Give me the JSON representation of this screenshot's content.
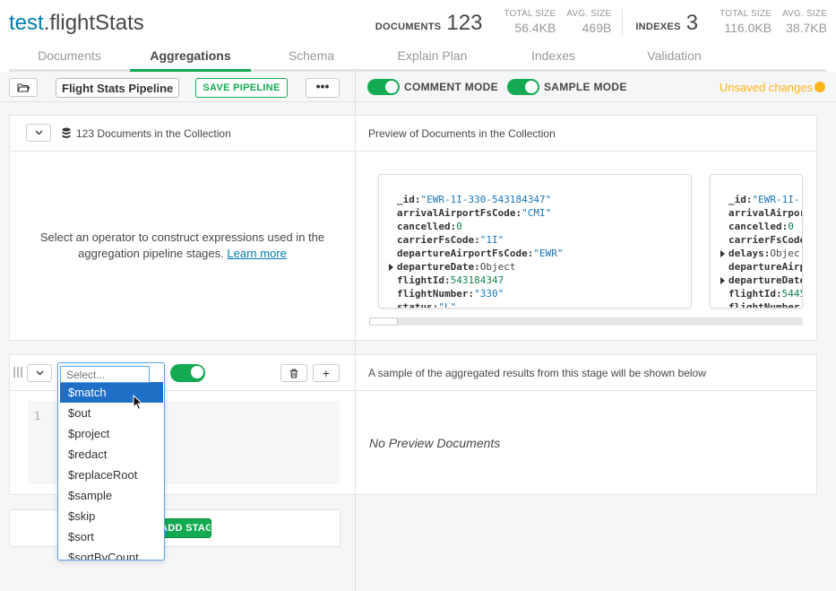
{
  "namespace": {
    "db": "test",
    "collection": ".flightStats"
  },
  "stats": {
    "documents_label": "DOCUMENTS",
    "documents_count": "123",
    "doc_total_size_label": "TOTAL SIZE",
    "doc_total_size": "56.4KB",
    "doc_avg_size_label": "AVG. SIZE",
    "doc_avg_size": "469B",
    "indexes_label": "INDEXES",
    "indexes_count": "3",
    "idx_total_size_label": "TOTAL SIZE",
    "idx_total_size": "116.0KB",
    "idx_avg_size_label": "AVG. SIZE",
    "idx_avg_size": "38.7KB"
  },
  "tabs": [
    "Documents",
    "Aggregations",
    "Schema",
    "Explain Plan",
    "Indexes",
    "Validation"
  ],
  "toolbar": {
    "pipeline_name": "Flight Stats Pipeline",
    "save_label": "SAVE PIPELINE",
    "more_label": "•••",
    "comment_mode_label": "COMMENT MODE",
    "sample_mode_label": "SAMPLE MODE",
    "unsaved_label": "Unsaved changes"
  },
  "colors": {
    "accent_green": "#13aa52",
    "link_blue": "#007cad",
    "warning": "#ffb618",
    "selection_blue": "#1f6fc6"
  },
  "source_stage": {
    "count_text": "123 Documents in the Collection",
    "message": "Select an operator to construct expressions used in the aggregation pipeline stages.",
    "learn_more": "Learn more",
    "preview_title": "Preview of Documents in the Collection"
  },
  "documents": [
    {
      "fields": [
        {
          "key": "_id:",
          "value": "\"EWR-1I-330-543184347\"",
          "type": "s",
          "expandable": false
        },
        {
          "key": "arrivalAirportFsCode:",
          "value": "\"CMI\"",
          "type": "s",
          "expandable": false
        },
        {
          "key": "cancelled:",
          "value": "0",
          "type": "n",
          "expandable": false
        },
        {
          "key": "carrierFsCode:",
          "value": "\"1I\"",
          "type": "s",
          "expandable": false
        },
        {
          "key": "departureAirportFsCode:",
          "value": "\"EWR\"",
          "type": "s",
          "expandable": false
        },
        {
          "key": "departureDate:",
          "value": "Object",
          "type": "o",
          "expandable": true
        },
        {
          "key": "flightId:",
          "value": "543184347",
          "type": "n",
          "expandable": false
        },
        {
          "key": "flightNumber:",
          "value": "\"330\"",
          "type": "s",
          "expandable": false
        },
        {
          "key": "status:",
          "value": "\"L\"",
          "type": "s",
          "expandable": false
        }
      ]
    },
    {
      "fields": [
        {
          "key": "_id:",
          "value": "\"EWR-1I-",
          "type": "s",
          "expandable": false
        },
        {
          "key": "arrivalAirpor",
          "value": "",
          "type": "s",
          "expandable": false
        },
        {
          "key": "cancelled:",
          "value": "0",
          "type": "n",
          "expandable": false
        },
        {
          "key": "carrierFsCode",
          "value": "",
          "type": "s",
          "expandable": false
        },
        {
          "key": "delays:",
          "value": "Objec",
          "type": "o",
          "expandable": true
        },
        {
          "key": "departureAirp",
          "value": "",
          "type": "s",
          "expandable": false
        },
        {
          "key": "departureDate",
          "value": "",
          "type": "o",
          "expandable": true
        },
        {
          "key": "flightId:",
          "value": "5445",
          "type": "n",
          "expandable": false
        },
        {
          "key": "flightNumber:",
          "value": "",
          "type": "s",
          "expandable": false
        }
      ]
    }
  ],
  "stage": {
    "select_placeholder": "Select...",
    "line_number": "1",
    "preview_title": "A sample of the aggregated results from this stage will be shown below",
    "no_preview": "No Preview Documents",
    "delete_icon": "trash-icon",
    "add_label": "+"
  },
  "add_stage_label": "ADD STAGE",
  "operators": [
    "$match",
    "$out",
    "$project",
    "$redact",
    "$replaceRoot",
    "$sample",
    "$skip",
    "$sort",
    "$sortByCount"
  ]
}
